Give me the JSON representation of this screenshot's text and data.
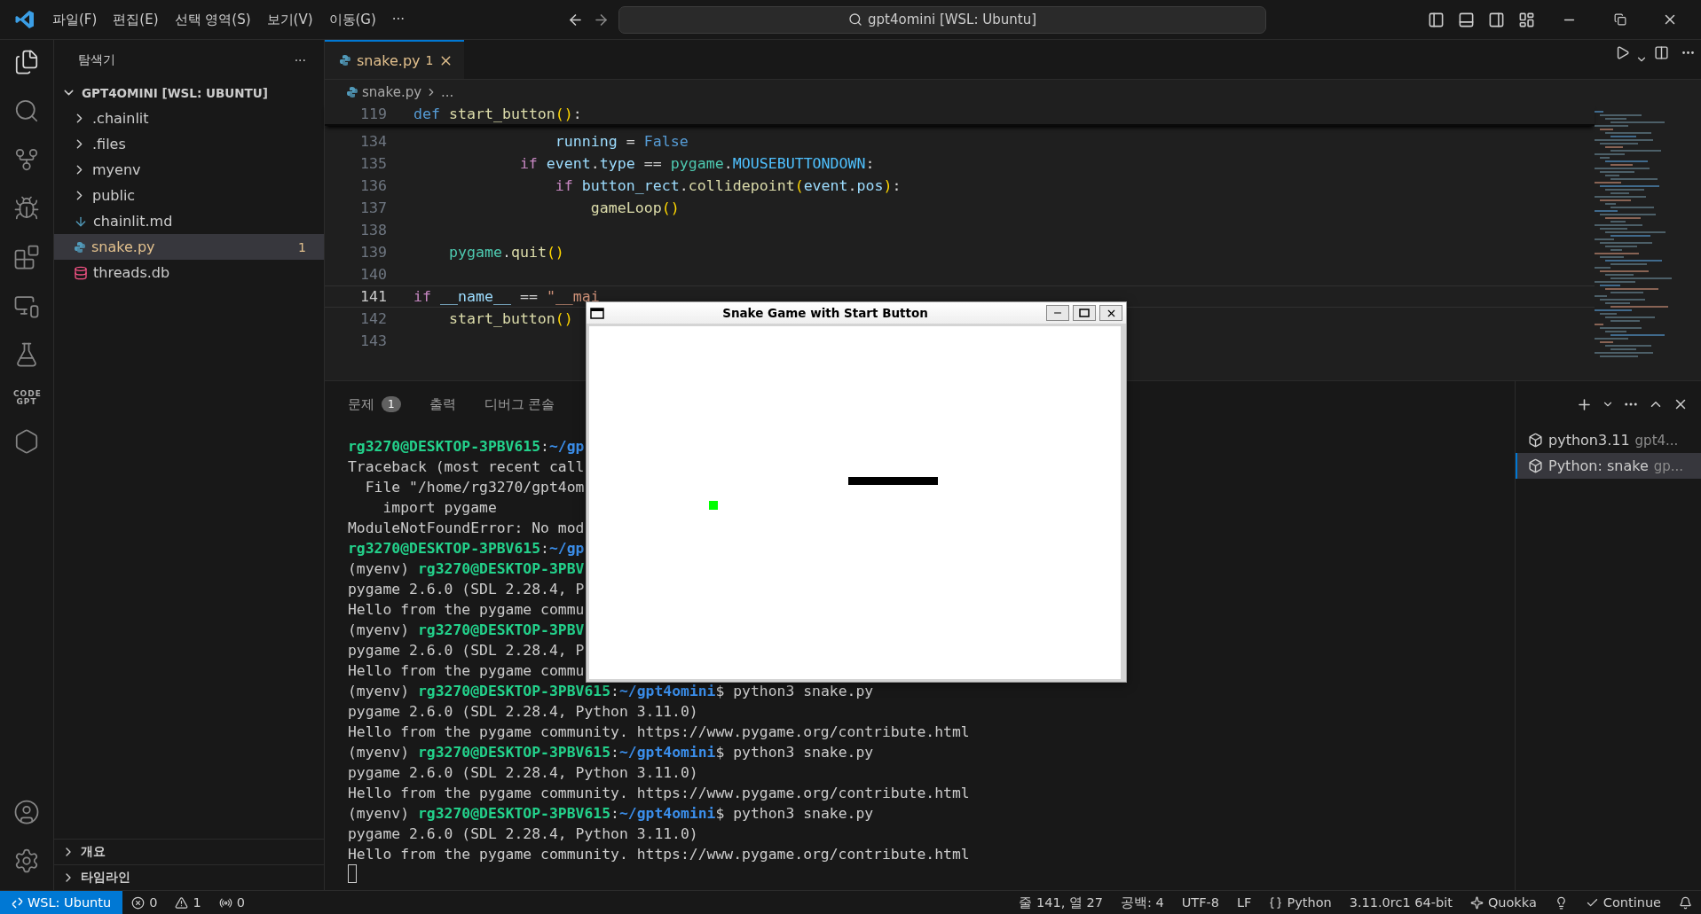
{
  "menu": {
    "items": [
      "파일(F)",
      "편집(E)",
      "선택 영역(S)",
      "보기(V)",
      "이동(G)",
      "···"
    ]
  },
  "command_center": {
    "text": "gpt4omini [WSL: Ubuntu]"
  },
  "activity_bar": {
    "badge_text": "CODE GPT"
  },
  "explorer": {
    "title": "탐색기",
    "more": "···",
    "root": {
      "label": "GPT4OMINI [WSL: UBUNTU]",
      "expanded": true,
      "children": [
        {
          "label": ".chainlit",
          "kind": "folder",
          "expanded": false,
          "selected": false
        },
        {
          "label": ".files",
          "kind": "folder",
          "expanded": false,
          "selected": false
        },
        {
          "label": "myenv",
          "kind": "folder",
          "expanded": false,
          "selected": false
        },
        {
          "label": "public",
          "kind": "folder",
          "expanded": false,
          "selected": false
        },
        {
          "label": "chainlit.md",
          "kind": "markdown",
          "selected": false
        },
        {
          "label": "snake.py",
          "kind": "python",
          "selected": true,
          "badge": "1"
        },
        {
          "label": "threads.db",
          "kind": "database",
          "selected": false
        }
      ]
    },
    "sections": [
      {
        "label": "개요",
        "expanded": false
      },
      {
        "label": "타임라인",
        "expanded": false
      }
    ]
  },
  "editor": {
    "tabs": [
      {
        "label": "snake.py",
        "badge": "1",
        "selected": true
      }
    ],
    "breadcrumbs": [
      "snake.py",
      "..."
    ],
    "lines": [
      {
        "number": "119",
        "sticky": true,
        "current": false,
        "tokens": [
          {
            "t": "def ",
            "kind": "keyword"
          },
          {
            "t": "start_button",
            "kind": "function"
          },
          {
            "t": "()",
            "kind": "bracket"
          },
          {
            "t": ":",
            "kind": "plain"
          }
        ]
      },
      {
        "number": "134",
        "sticky": false,
        "current": false,
        "tokens": [
          {
            "t": "                running",
            "kind": "variable"
          },
          {
            "t": " = ",
            "kind": "plain"
          },
          {
            "t": "False",
            "kind": "keyword"
          }
        ]
      },
      {
        "number": "135",
        "sticky": false,
        "current": false,
        "tokens": [
          {
            "t": "            if ",
            "kind": "control"
          },
          {
            "t": "event",
            "kind": "variable"
          },
          {
            "t": ".",
            "kind": "plain"
          },
          {
            "t": "type",
            "kind": "variable"
          },
          {
            "t": " == ",
            "kind": "plain"
          },
          {
            "t": "pygame",
            "kind": "module"
          },
          {
            "t": ".",
            "kind": "plain"
          },
          {
            "t": "MOUSEBUTTONDOWN",
            "kind": "constant"
          },
          {
            "t": ":",
            "kind": "plain"
          }
        ]
      },
      {
        "number": "136",
        "sticky": false,
        "current": false,
        "tokens": [
          {
            "t": "                if ",
            "kind": "control"
          },
          {
            "t": "button_rect",
            "kind": "variable"
          },
          {
            "t": ".",
            "kind": "plain"
          },
          {
            "t": "collidepoint",
            "kind": "function"
          },
          {
            "t": "(",
            "kind": "bracket"
          },
          {
            "t": "event",
            "kind": "variable"
          },
          {
            "t": ".",
            "kind": "plain"
          },
          {
            "t": "pos",
            "kind": "variable"
          },
          {
            "t": ")",
            "kind": "bracket"
          },
          {
            "t": ":",
            "kind": "plain"
          }
        ]
      },
      {
        "number": "137",
        "sticky": false,
        "current": false,
        "tokens": [
          {
            "t": "                    gameLoop",
            "kind": "function"
          },
          {
            "t": "()",
            "kind": "bracket"
          }
        ]
      },
      {
        "number": "138",
        "sticky": false,
        "current": false
      },
      {
        "number": "139",
        "sticky": false,
        "current": false,
        "tokens": [
          {
            "t": "    pygame",
            "kind": "module"
          },
          {
            "t": ".",
            "kind": "plain"
          },
          {
            "t": "quit",
            "kind": "function"
          },
          {
            "t": "()",
            "kind": "bracket"
          }
        ]
      },
      {
        "number": "140",
        "sticky": false,
        "current": false
      },
      {
        "number": "141",
        "sticky": false,
        "current": true,
        "tokens": [
          {
            "t": "if ",
            "kind": "control"
          },
          {
            "t": "__name__",
            "kind": "variable"
          },
          {
            "t": " == ",
            "kind": "plain"
          },
          {
            "t": "\"__mai",
            "kind": "string"
          }
        ]
      },
      {
        "number": "142",
        "sticky": false,
        "current": false,
        "tokens": [
          {
            "t": "    start_button",
            "kind": "function"
          },
          {
            "t": "()",
            "kind": "bracket"
          }
        ]
      },
      {
        "number": "143",
        "sticky": false,
        "current": false
      }
    ]
  },
  "panel": {
    "tabs": [
      {
        "label": "문제",
        "badge": "1",
        "selected": false
      },
      {
        "label": "출력",
        "selected": false
      },
      {
        "label": "디버그 콘솔",
        "selected": false
      }
    ],
    "terminal_lines": [
      [
        {
          "t": "rg3270@DESKTOP-3PBV615",
          "kind": "user"
        },
        {
          "t": ":",
          "kind": "plain"
        },
        {
          "t": "~/gp",
          "kind": "path"
        }
      ],
      [
        {
          "t": "Traceback (most recent call",
          "kind": "plain"
        }
      ],
      [
        {
          "t": "  File \"/home/rg3270/gpt4om",
          "kind": "plain"
        }
      ],
      [
        {
          "t": "    import pygame",
          "kind": "plain"
        }
      ],
      [
        {
          "t": "ModuleNotFoundError: No mod",
          "kind": "plain"
        }
      ],
      [
        {
          "t": "rg3270@DESKTOP-3PBV615",
          "kind": "user"
        },
        {
          "t": ":",
          "kind": "plain"
        },
        {
          "t": "~/gp",
          "kind": "path"
        }
      ],
      [
        {
          "t": "(myenv) ",
          "kind": "plain"
        },
        {
          "t": "rg3270@DESKTOP-3PBV",
          "kind": "user"
        }
      ],
      [
        {
          "t": "pygame 2.6.0 (SDL 2.28.4, P",
          "kind": "plain"
        }
      ],
      [
        {
          "t": "Hello from the pygame commu",
          "kind": "plain"
        }
      ],
      [
        {
          "t": "(myenv) ",
          "kind": "plain"
        },
        {
          "t": "rg3270@DESKTOP-3PBV",
          "kind": "user"
        }
      ],
      [
        {
          "t": "pygame 2.6.0 (SDL 2.28.4, P",
          "kind": "plain"
        }
      ],
      [
        {
          "t": "Hello from the pygame commu",
          "kind": "plain"
        }
      ],
      [
        {
          "t": "(myenv) ",
          "kind": "plain"
        },
        {
          "t": "rg3270@DESKTOP-3PBV615",
          "kind": "user"
        },
        {
          "t": ":",
          "kind": "plain"
        },
        {
          "t": "~/gpt4omini",
          "kind": "path"
        },
        {
          "t": "$ python3 snake.py",
          "kind": "plain"
        }
      ],
      [
        {
          "t": "pygame 2.6.0 (SDL 2.28.4, Python 3.11.0)",
          "kind": "plain"
        }
      ],
      [
        {
          "t": "Hello from the pygame community. https://www.pygame.org/contribute.html",
          "kind": "plain"
        }
      ],
      [
        {
          "t": "(myenv) ",
          "kind": "plain"
        },
        {
          "t": "rg3270@DESKTOP-3PBV615",
          "kind": "user"
        },
        {
          "t": ":",
          "kind": "plain"
        },
        {
          "t": "~/gpt4omini",
          "kind": "path"
        },
        {
          "t": "$ python3 snake.py",
          "kind": "plain"
        }
      ],
      [
        {
          "t": "pygame 2.6.0 (SDL 2.28.4, Python 3.11.0)",
          "kind": "plain"
        }
      ],
      [
        {
          "t": "Hello from the pygame community. https://www.pygame.org/contribute.html",
          "kind": "plain"
        }
      ],
      [
        {
          "t": "(myenv) ",
          "kind": "plain"
        },
        {
          "t": "rg3270@DESKTOP-3PBV615",
          "kind": "user"
        },
        {
          "t": ":",
          "kind": "plain"
        },
        {
          "t": "~/gpt4omini",
          "kind": "path"
        },
        {
          "t": "$ python3 snake.py",
          "kind": "plain"
        }
      ],
      [
        {
          "t": "pygame 2.6.0 (SDL 2.28.4, Python 3.11.0)",
          "kind": "plain"
        }
      ],
      [
        {
          "t": "Hello from the pygame community. https://www.pygame.org/contribute.html",
          "kind": "plain"
        }
      ]
    ],
    "terminals": [
      {
        "name": "python3.11",
        "detail": "gpt4...",
        "selected": false
      },
      {
        "name": "Python: snake",
        "detail": "gp...",
        "selected": true
      }
    ]
  },
  "game_window": {
    "title": "Snake Game with Start Button"
  },
  "status_bar": {
    "left": [
      {
        "kind": "remote",
        "text": "WSL: Ubuntu"
      },
      {
        "kind": "errors",
        "text": "0"
      },
      {
        "kind": "warnings",
        "text": "1"
      },
      {
        "kind": "ports",
        "text": "0"
      }
    ],
    "right": [
      {
        "kind": "plain",
        "text": "줄 141, 열 27"
      },
      {
        "kind": "plain",
        "text": "공백: 4"
      },
      {
        "kind": "plain",
        "text": "UTF-8"
      },
      {
        "kind": "plain",
        "text": "LF"
      },
      {
        "kind": "language",
        "text": "Python"
      },
      {
        "kind": "plain",
        "text": "3.11.0rc1 64-bit"
      },
      {
        "kind": "quokka",
        "text": "Quokka"
      },
      {
        "kind": "bulb"
      },
      {
        "kind": "check",
        "text": "Continue"
      },
      {
        "kind": "bell"
      }
    ]
  }
}
